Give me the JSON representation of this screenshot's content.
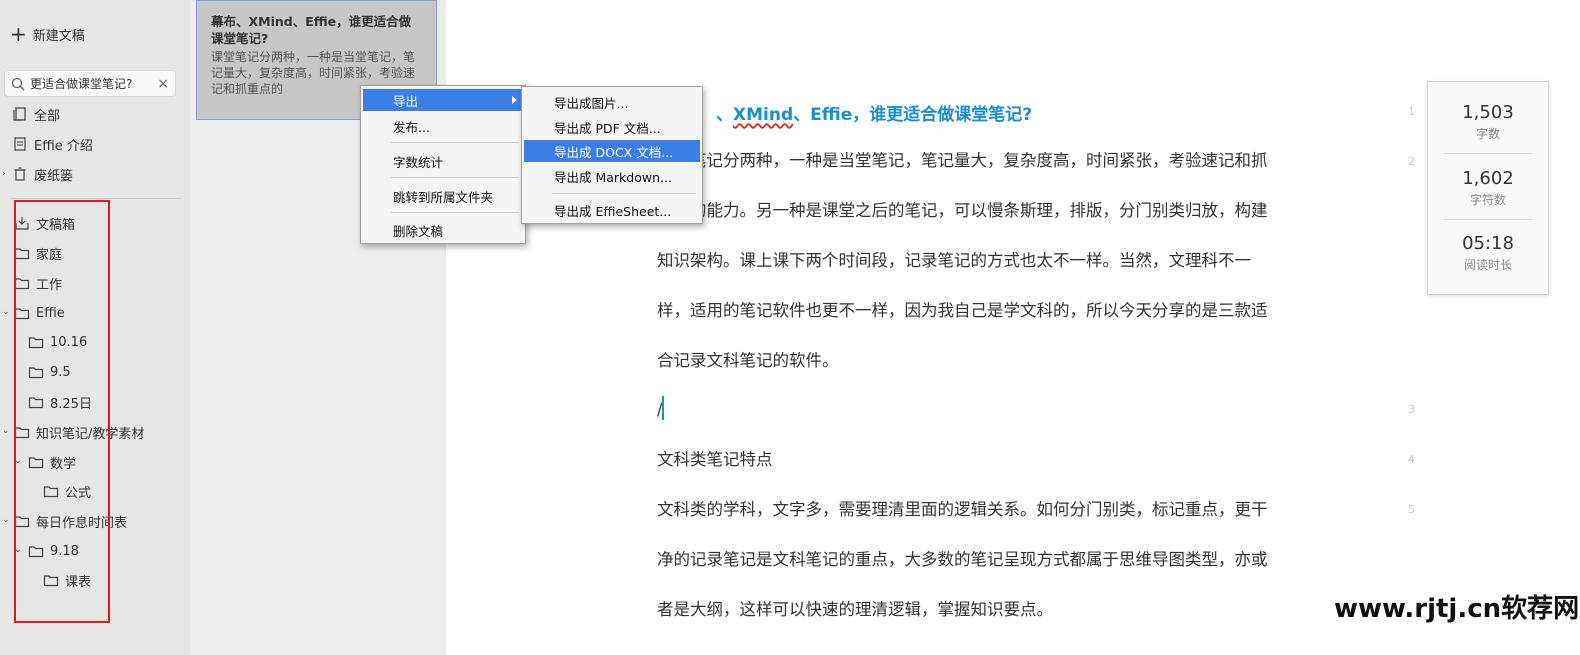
{
  "sidebar": {
    "new_doc_label": "新建文稿",
    "search_value": "更适合做课堂笔记?",
    "top_items": [
      {
        "label": "全部"
      },
      {
        "label": "Effie 介绍"
      },
      {
        "label": "废纸篓"
      }
    ],
    "folders": [
      {
        "label": "文稿箱"
      },
      {
        "label": "家庭"
      },
      {
        "label": "工作"
      },
      {
        "label": "Effie"
      },
      {
        "label": "10.16"
      },
      {
        "label": "9.5"
      },
      {
        "label": "8.25日"
      },
      {
        "label": "知识笔记/教学素材"
      },
      {
        "label": "数学"
      },
      {
        "label": "公式"
      },
      {
        "label": "每日作息时间表"
      },
      {
        "label": "9.18"
      },
      {
        "label": "课表"
      }
    ]
  },
  "doclist": {
    "card_title": "幕布、XMind、Effie，谁更适合做课堂笔记?",
    "card_preview": "课堂笔记分两种，一种是当堂笔记，笔记量大，复杂度高，时间紧张，考验速记和抓重点的"
  },
  "context_menu": {
    "items": [
      "导出",
      "发布...",
      "字数统计",
      "跳转到所属文件夹",
      "删除文稿"
    ]
  },
  "export_submenu": {
    "items": [
      "导出成图片...",
      "导出成 PDF 文档...",
      "导出成 DOCX 文档...",
      "导出成 Markdown...",
      "导出成 EffieSheet..."
    ]
  },
  "editor": {
    "title_prefix": "、",
    "title_underlined": "XMind",
    "title_rest": "、Effie，谁更适合做课堂笔记?",
    "lines": [
      "笔记分两种，一种是当堂笔记，笔记量大，复杂度高，时间紧张，考验速记和抓",
      "的能力。另一种是课堂之后的笔记，可以慢条斯理，排版，分门别类归放，构建",
      "知识架构。课上课下两个时间段，记录笔记的方式也太不一样。当然，文理科不一",
      "样，适用的笔记软件也更不一样，因为我自己是学文科的，所以今天分享的是三款适",
      "合记录文科笔记的软件。"
    ],
    "slash_line": "/",
    "heading": "文科类笔记特点",
    "lines2": [
      "文科类的学科，文字多，需要理清里面的逻辑关系。如何分门别类，标记重点，更干",
      "净的记录笔记是文科笔记的重点，大多数的笔记呈现方式都属于思维导图类型，亦或",
      "者是大纲，这样可以快速的理清逻辑，掌握知识要点。"
    ],
    "line_numbers": [
      "1",
      "2",
      "3",
      "4",
      "5"
    ]
  },
  "stats": {
    "words_value": "1,503",
    "words_label": "字数",
    "chars_value": "1,602",
    "chars_label": "字符数",
    "time_value": "05:18",
    "time_label": "阅读时长"
  },
  "watermark": "www.rjtj.cn软荐网",
  "colors": {
    "accent": "#1a8fd0",
    "menu_highlight": "#3b7ee6",
    "annotation_red": "#e01b1b"
  }
}
